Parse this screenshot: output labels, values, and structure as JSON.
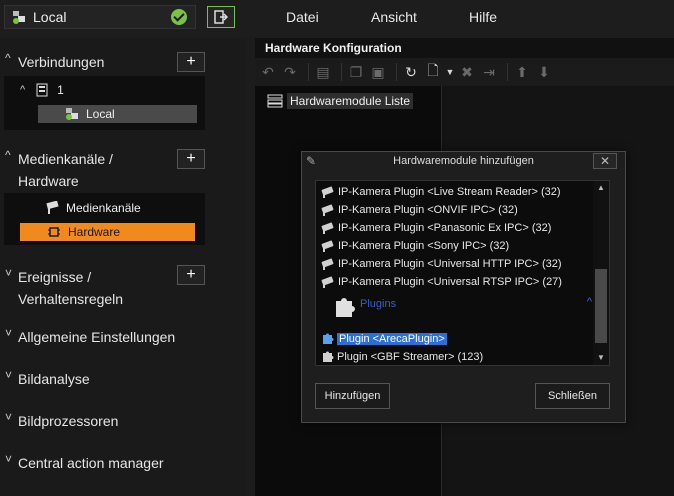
{
  "topbar": {
    "connection_name": "Local",
    "status_icon": "check-circle-icon",
    "menu": [
      "Datei",
      "Ansicht",
      "Hilfe"
    ]
  },
  "sidebar": {
    "sections": [
      {
        "title": "Verbindungen",
        "expanded": true,
        "has_add": true
      },
      {
        "title_line1": "Medienkanäle /",
        "title_line2": "Hardware",
        "expanded": true,
        "has_add": true
      },
      {
        "title_line1": "Ereignisse /",
        "title_line2": "Verhaltensregeln",
        "expanded": false,
        "has_add": true
      },
      {
        "title": "Allgemeine Einstellungen",
        "expanded": false
      },
      {
        "title": "Bildanalyse",
        "expanded": false
      },
      {
        "title": "Bildprozessoren",
        "expanded": false
      },
      {
        "title": "Central action manager",
        "expanded": false
      }
    ],
    "connections_tree": {
      "root": "1",
      "child": "Local"
    },
    "media_tree": {
      "item1": "Medienkanäle",
      "item2": "Hardware"
    },
    "add_label": "+"
  },
  "main": {
    "title": "Hardware Konfiguration",
    "root_label": "Hardwaremodule Liste"
  },
  "dialog": {
    "title": "Hardwaremodule hinzufügen",
    "close_label": "✕",
    "items": [
      "IP-Kamera Plugin <Live Stream Reader> (32)",
      "IP-Kamera Plugin <ONVIF IPC> (32)",
      "IP-Kamera Plugin <Panasonic Ex IPC> (32)",
      "IP-Kamera Plugin <Sony IPC> (32)",
      "IP-Kamera Plugin <Universal HTTP IPC> (32)",
      "IP-Kamera Plugin <Universal RTSP IPC> (27)"
    ],
    "group_label": "Plugins",
    "plugins": [
      "Plugin <ArecaPlugin>",
      "Plugin <GBF Streamer> (123)"
    ],
    "add_button": "Hinzufügen",
    "close_button": "Schließen"
  },
  "colors": {
    "accent_orange": "#f08a1c",
    "selection_blue": "#2c6fd6",
    "ok_green": "#7cc242"
  }
}
